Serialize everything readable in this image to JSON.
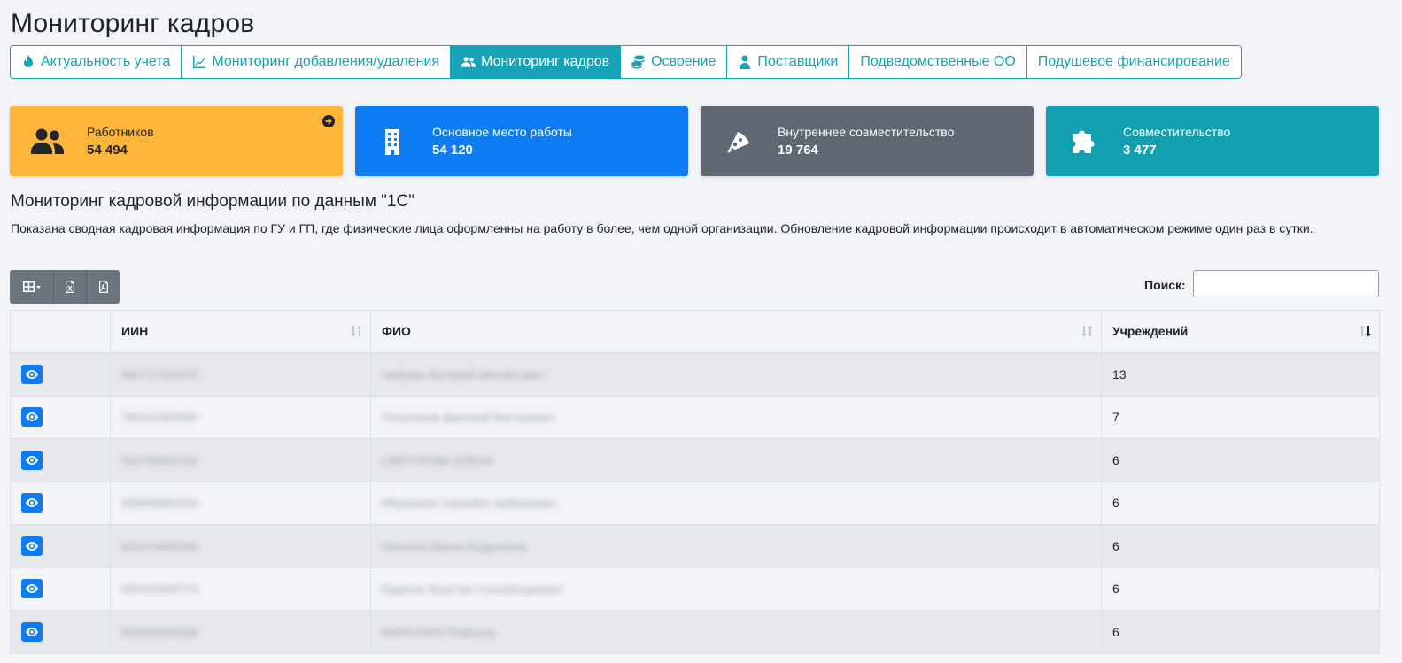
{
  "page": {
    "title": "Мониторинг кадров"
  },
  "tabs": [
    {
      "label": "Актуальность учета",
      "icon": "fire-icon",
      "active": false
    },
    {
      "label": "Мониторинг добавления/удаления",
      "icon": "line-chart-icon",
      "active": false
    },
    {
      "label": "Мониторинг кадров",
      "icon": "users-icon",
      "active": true
    },
    {
      "label": "Освоение",
      "icon": "coins-icon",
      "active": false
    },
    {
      "label": "Поставщики",
      "icon": "user-tie-icon",
      "active": false
    },
    {
      "label": "Подведомственные ОО",
      "icon": "",
      "active": false
    },
    {
      "label": "Подушевое финансирование",
      "icon": "",
      "active": false
    }
  ],
  "cards": [
    {
      "label": "Работников",
      "value": "54 494",
      "icon": "users-icon",
      "color": "#ffb43a"
    },
    {
      "label": "Основное место работы",
      "value": "54 120",
      "icon": "building-icon",
      "color": "#0d7cf2"
    },
    {
      "label": "Внутреннее совместительство",
      "value": "19 764",
      "icon": "pizza-slice-icon",
      "color": "#5f6770"
    },
    {
      "label": "Совместительство",
      "value": "3 477",
      "icon": "puzzle-icon",
      "color": "#129fb0"
    }
  ],
  "section": {
    "title": "Мониторинг кадровой информации по данным \"1С\"",
    "description": "Показана сводная кадровая информация по ГУ и ГП, где физические лица оформленны на работу в более, чем одной организации. Обновление кадровой информации происходит в автоматическом режиме один раз в сутки."
  },
  "search": {
    "label": "Поиск:",
    "value": "",
    "placeholder": ""
  },
  "table": {
    "columns": [
      "",
      "ИИН",
      "ФИО",
      "Учреждений"
    ],
    "rows": [
      {
        "iin": "880727300970",
        "fio": "Чебукин Валерий Михайлович",
        "count": "13"
      },
      {
        "iin": "790215300560",
        "fio": "Полуляхов Дмитрий Викторович",
        "count": "7"
      },
      {
        "iin": "531780400760",
        "fio": "СВЯТУЛОВА ЕЛЕНА",
        "count": "6"
      },
      {
        "iin": "830808300220",
        "fio": "Ибраимов Серикбек Арбаевович",
        "count": "6"
      },
      {
        "iin": "801074400284",
        "fio": "Ионкина Ирина Андреевна",
        "count": "6"
      },
      {
        "iin": "680502300715",
        "fio": "Кудусов Арыстан Сатыбалдиевич",
        "count": "6"
      },
      {
        "iin": "850808300336",
        "fio": "МИРКУЛИН Рафаэль",
        "count": "6"
      }
    ]
  }
}
